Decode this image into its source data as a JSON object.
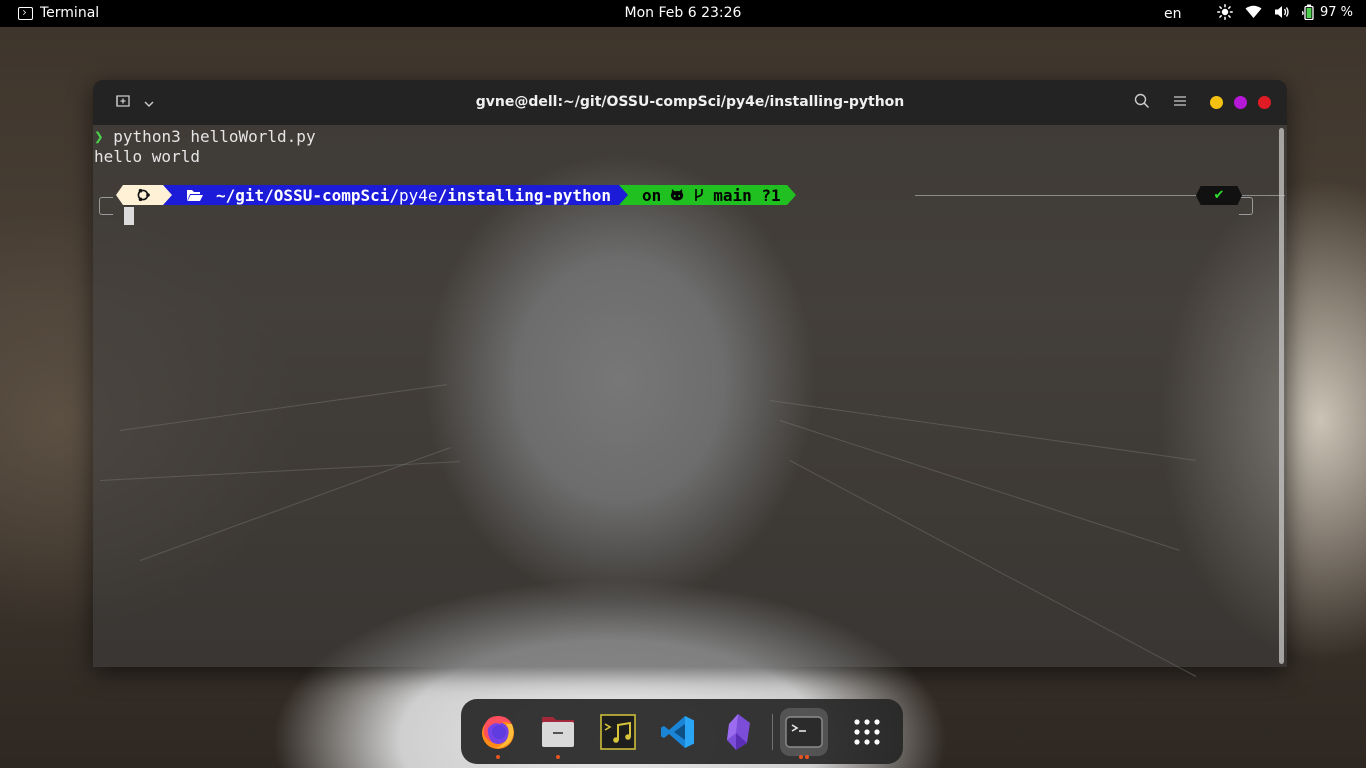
{
  "top_bar": {
    "app_name": "Terminal",
    "clock": "Mon Feb 6  23:26",
    "language": "en",
    "battery": "97 %",
    "icons": [
      "terminal-icon",
      "brightness-icon",
      "wifi-icon",
      "volume-icon",
      "battery-icon"
    ]
  },
  "terminal": {
    "window_title": "gvne@dell:~/git/OSSU-compSci/py4e/installing-python",
    "history": [
      {
        "prompt_symbol": "❯",
        "command": "python3 helloWorld.py"
      },
      {
        "output": "hello world"
      }
    ],
    "prompt": {
      "path_home": "~/git/OSSU-compSci/",
      "path_mid": "py4e",
      "path_sep": "/",
      "path_tail": "installing-python",
      "git_on": "on",
      "git_branch_icon": "branch-icon",
      "git_branch": "main",
      "git_status": "?1",
      "status_mark": "✔"
    },
    "colors": {
      "os_segment": "#fff1d6",
      "path_segment": "#1b1bd8",
      "git_segment": "#20c020",
      "prompt_arrow": "#4bd34b"
    }
  },
  "window_controls": [
    "new-tab-icon",
    "dropdown-icon",
    "search-icon",
    "menu-icon",
    "minimize-dot",
    "maximize-dot",
    "close-dot"
  ],
  "dock": {
    "apps": [
      {
        "name": "Firefox",
        "icon": "firefox-icon",
        "running": true
      },
      {
        "name": "Files",
        "icon": "files-icon",
        "running": true
      },
      {
        "name": "Rhythmbox",
        "icon": "music-terminal-icon",
        "running": false
      },
      {
        "name": "Visual Studio Code",
        "icon": "vscode-icon",
        "running": false
      },
      {
        "name": "Obsidian",
        "icon": "obsidian-icon",
        "running": false
      },
      {
        "name": "Terminal",
        "icon": "terminal-icon",
        "running": true
      },
      {
        "name": "Show Applications",
        "icon": "app-grid-icon",
        "running": false
      }
    ]
  }
}
